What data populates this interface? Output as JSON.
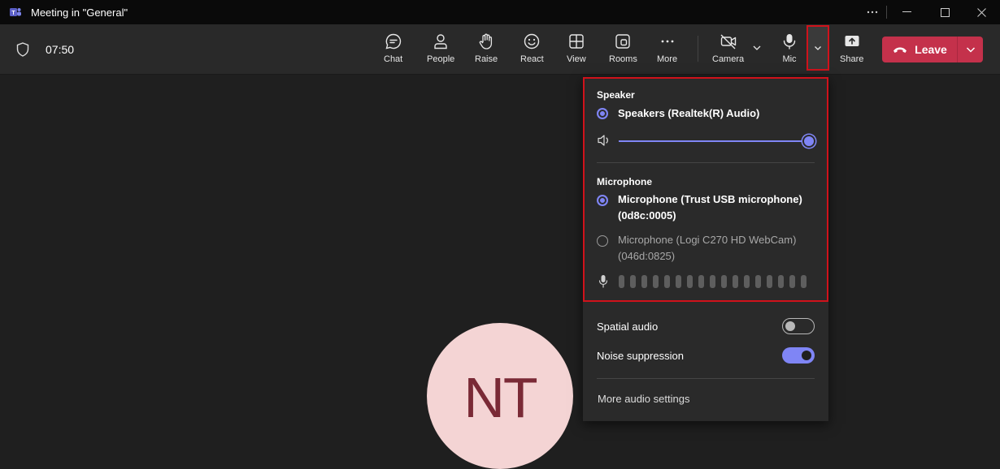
{
  "window": {
    "title": "Meeting in \"General\"",
    "app_icon": "teams-logo",
    "controls": [
      "more-icon",
      "minimize-icon",
      "maximize-icon",
      "close-icon"
    ]
  },
  "toolbar": {
    "timer": "07:50",
    "buttons": {
      "chat": {
        "label": "Chat",
        "icon": "chat-icon"
      },
      "people": {
        "label": "People",
        "icon": "people-icon"
      },
      "raise": {
        "label": "Raise",
        "icon": "hand-icon"
      },
      "react": {
        "label": "React",
        "icon": "smiley-icon"
      },
      "view": {
        "label": "View",
        "icon": "grid-icon"
      },
      "rooms": {
        "label": "Rooms",
        "icon": "rooms-icon"
      },
      "more": {
        "label": "More",
        "icon": "more-icon"
      },
      "camera": {
        "label": "Camera",
        "icon": "camera-off-icon"
      },
      "mic": {
        "label": "Mic",
        "icon": "mic-icon"
      },
      "share": {
        "label": "Share",
        "icon": "share-icon"
      }
    },
    "leave": {
      "label": "Leave",
      "color": "#c4314b"
    }
  },
  "avatar": {
    "initials": "NT",
    "background": "#f4d4d4",
    "text_color": "#7a2a36"
  },
  "device_panel": {
    "speaker": {
      "heading": "Speaker",
      "options": [
        {
          "label": "Speakers (Realtek(R) Audio)",
          "selected": true
        }
      ],
      "volume_percent": 100
    },
    "microphone": {
      "heading": "Microphone",
      "options": [
        {
          "line1": "Microphone (Trust USB microphone)",
          "line2": "(0d8c:0005)",
          "selected": true
        },
        {
          "line1": "Microphone (Logi C270 HD WebCam)",
          "line2": "(046d:0825)",
          "selected": false
        }
      ],
      "level_bars_total": 17,
      "level_bars_active": 0
    },
    "spatial_audio": {
      "label": "Spatial audio",
      "enabled": false
    },
    "noise_suppression": {
      "label": "Noise suppression",
      "enabled": true
    },
    "more_settings": "More audio settings"
  },
  "colors": {
    "accent": "#7f85f5",
    "highlight_border": "#d0121b",
    "panel_bg": "#2a2a2a"
  }
}
